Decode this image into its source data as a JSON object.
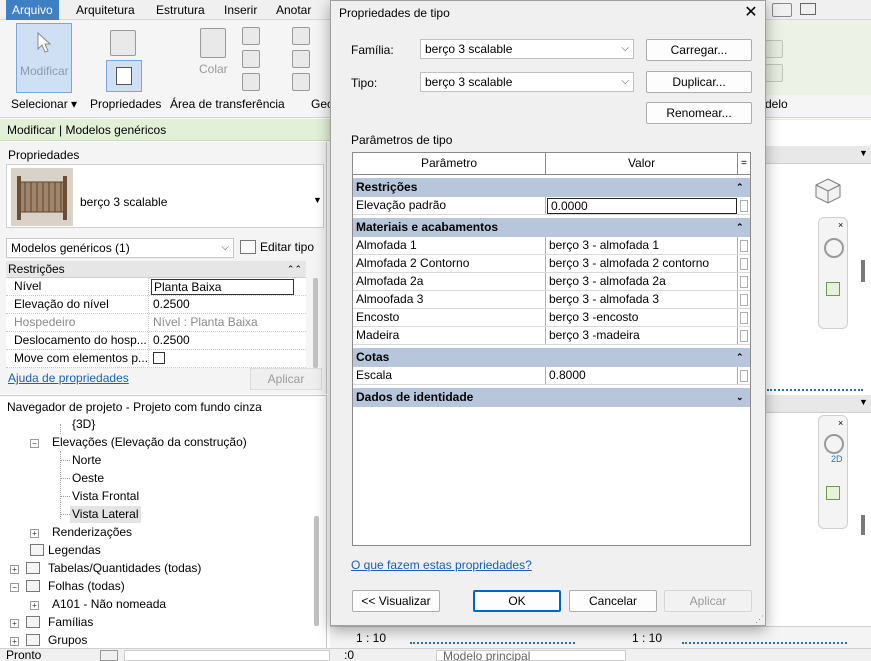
{
  "ribbon": {
    "tabs": [
      "Arquivo",
      "Arquitetura",
      "Estrutura",
      "Inserir",
      "Anotar"
    ],
    "modify_label": "Modificar",
    "paste_label": "Colar",
    "groups": [
      "Selecionar ▾",
      "Propriedades",
      "Área de transferência",
      "Geo",
      "delo"
    ]
  },
  "context_bar": "Modificar | Modelos genéricos",
  "properties": {
    "title": "Propriedades",
    "type_name": "berço 3 scalable",
    "category_select": "Modelos genéricos (1)",
    "edit_type": "Editar tipo",
    "section": "Restrições",
    "rows": [
      {
        "label": "Nível",
        "value": "Planta Baixa"
      },
      {
        "label": "Elevação do nível",
        "value": "0.2500"
      },
      {
        "label": "Hospedeiro",
        "value": "Nível : Planta Baixa"
      },
      {
        "label": "Deslocamento do hosp...",
        "value": "0.2500"
      },
      {
        "label": "Move com elementos p...",
        "value": ""
      }
    ],
    "help_link": "Ajuda de propriedades",
    "apply": "Aplicar"
  },
  "browser": {
    "title": "Navegador de projeto - Projeto com fundo cinza",
    "nodes": {
      "n3d": "{3D}",
      "elevations": "Elevações (Elevação da construção)",
      "north": "Norte",
      "west": "Oeste",
      "front": "Vista Frontal",
      "side": "Vista Lateral",
      "renders": "Renderizações",
      "legends": "Legendas",
      "schedules": "Tabelas/Quantidades (todas)",
      "sheets": "Folhas (todas)",
      "a101": "A101 - Não nomeada",
      "families": "Famílias",
      "groups": "Grupos"
    }
  },
  "status": {
    "ready": "Pronto",
    "zero": ":0",
    "model": "Modelo principal"
  },
  "views": {
    "scale": "1 : 10",
    "badge_2d": "2D"
  },
  "dialog": {
    "title": "Propriedades de tipo",
    "family_label": "Família:",
    "family_value": "berço 3 scalable",
    "type_label": "Tipo:",
    "type_value": "berço 3 scalable",
    "load": "Carregar...",
    "duplicate": "Duplicar...",
    "rename": "Renomear...",
    "params_title": "Parâmetros de tipo",
    "col_param": "Parâmetro",
    "col_value": "Valor",
    "col_eq": "=",
    "groups": [
      {
        "title": "Restrições",
        "rows": [
          {
            "label": "Elevação padrão",
            "value": "0.0000"
          }
        ]
      },
      {
        "title": "Materiais e acabamentos",
        "rows": [
          {
            "label": "Almofada 1",
            "value": "berço 3 - almofada 1"
          },
          {
            "label": "Almofada 2  Contorno",
            "value": "berço 3 - almofada 2 contorno"
          },
          {
            "label": "Almofada 2a",
            "value": "berço 3 - almofada 2a"
          },
          {
            "label": "Almoofada 3",
            "value": "berço 3 - almofada 3"
          },
          {
            "label": "Encosto",
            "value": "berço 3 -encosto"
          },
          {
            "label": "Madeira",
            "value": "berço 3 -madeira"
          }
        ]
      },
      {
        "title": "Cotas",
        "rows": [
          {
            "label": "Escala",
            "value": "0.8000"
          }
        ]
      },
      {
        "title": "Dados de identidade",
        "rows": []
      }
    ],
    "help_link": "O que fazem estas propriedades?",
    "preview": "<< Visualizar",
    "ok": "OK",
    "cancel": "Cancelar",
    "apply": "Aplicar"
  },
  "icons": {
    "close": "close-icon",
    "collapse": "collapse-icon",
    "expand": "expand-icon",
    "chevron": "chevron-down-icon"
  },
  "colors": {
    "accent": "#3f7fc4",
    "context_bar": "#e3f0d8",
    "group_header": "#b7c6da",
    "link": "#1a5fb4"
  }
}
